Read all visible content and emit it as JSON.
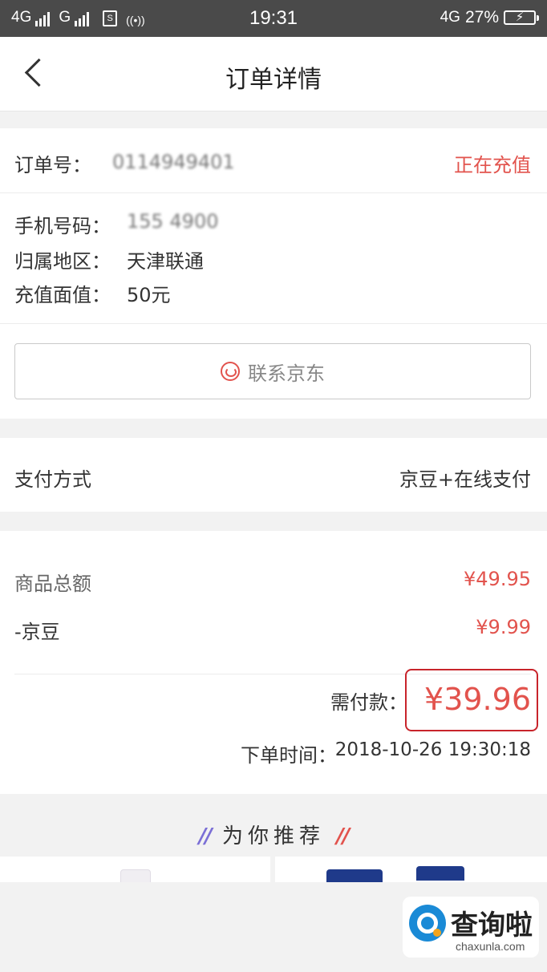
{
  "status_bar": {
    "network1": "4G",
    "network2": "G",
    "sim_icon": "S",
    "hotspot_icon": "((•))",
    "time": "19:31",
    "network3": "4G",
    "battery": "27%"
  },
  "header": {
    "title": "订单详情",
    "back_icon": "chevron-left-icon"
  },
  "order": {
    "number_label": "订单号：",
    "number_value": "0114949401",
    "status": "正在充值",
    "phone_label": "手机号码：",
    "phone_value": "155    4900",
    "region_label": "归属地区：",
    "region_value": "天津联通",
    "face_value_label": "充值面值：",
    "face_value_value": "50元",
    "contact_button": "联系京东"
  },
  "payment": {
    "label": "支付方式",
    "value": "京豆+在线支付"
  },
  "amounts": {
    "total_label": "商品总额",
    "total_value": "¥49.95",
    "beans_label": "-京豆",
    "beans_value": "¥9.99",
    "due_label": "需付款：",
    "due_value": "¥39.96",
    "time_label": "下单时间：",
    "time_value": "2018-10-26 19:30:18"
  },
  "recommend": {
    "title": "为你推荐",
    "left_mark": "//",
    "right_mark": "//"
  },
  "watermark": {
    "text": "查询啦",
    "sub": "chaxunla.com"
  },
  "colors": {
    "accent_red": "#e2534d",
    "box_red": "#c8242b",
    "status_bar": "#4a4a4a"
  }
}
